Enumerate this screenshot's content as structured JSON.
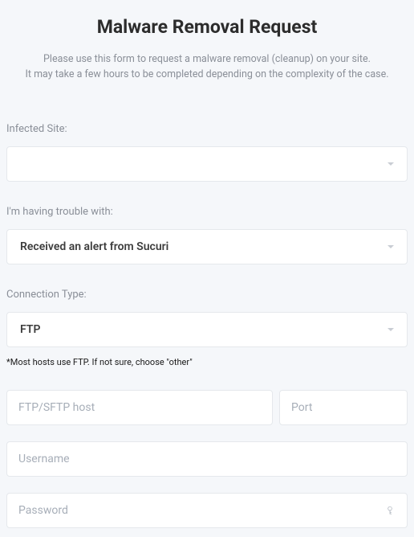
{
  "header": {
    "title": "Malware Removal Request",
    "subtitle_line1": "Please use this form to request a malware removal (cleanup) on your site.",
    "subtitle_line2": "It may take a few hours to be completed depending on the complexity of the case."
  },
  "form": {
    "infected_site": {
      "label": "Infected Site:",
      "value": ""
    },
    "trouble": {
      "label": "I'm having trouble with:",
      "value": "Received an alert from Sucuri"
    },
    "connection": {
      "label": "Connection Type:",
      "value": "FTP",
      "hint": "*Most hosts use FTP. If not sure, choose \"other\""
    },
    "host": {
      "placeholder": "FTP/SFTP host",
      "value": ""
    },
    "port": {
      "placeholder": "Port",
      "value": ""
    },
    "username": {
      "placeholder": "Username",
      "value": ""
    },
    "password": {
      "placeholder": "Password",
      "value": ""
    }
  }
}
